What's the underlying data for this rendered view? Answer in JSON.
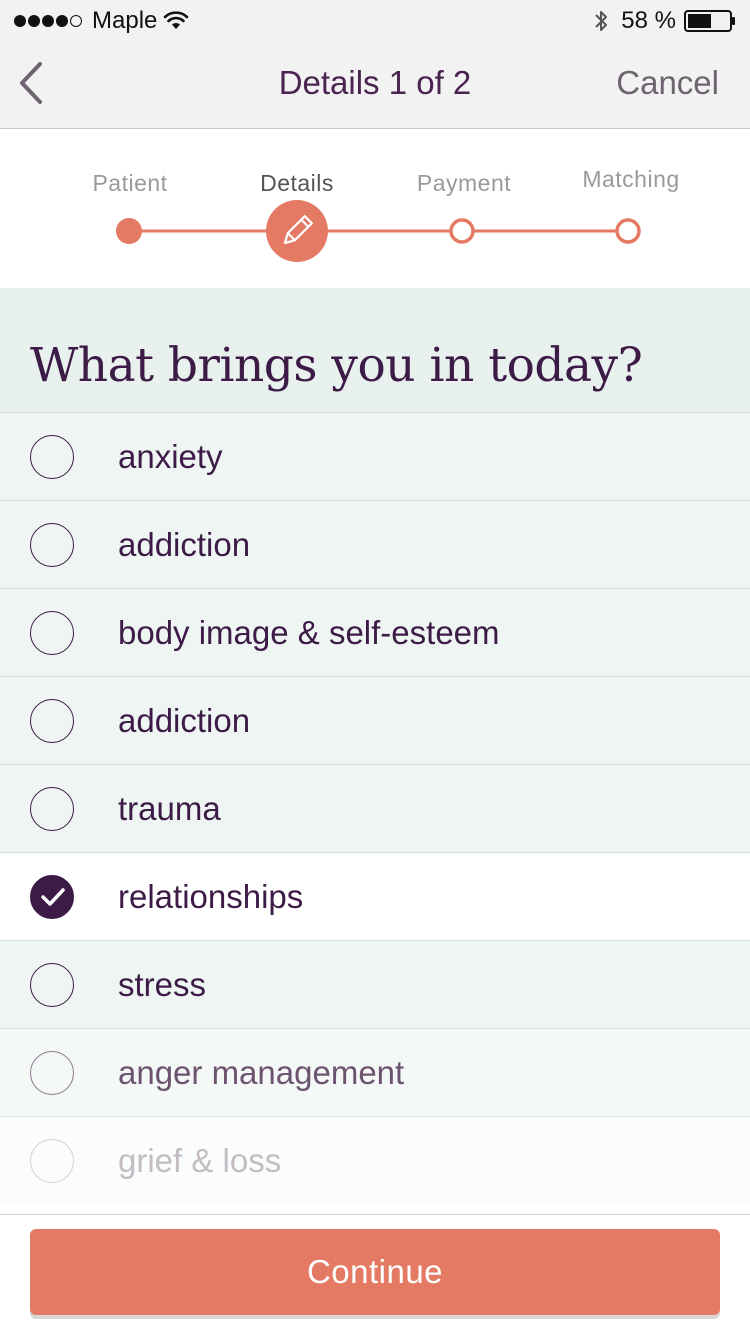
{
  "status_bar": {
    "carrier": "Maple",
    "battery_percent": "58 %",
    "signal_bars_filled": 4,
    "signal_bars_total": 5,
    "battery_level": 0.58,
    "icons": [
      "wifi-icon",
      "bluetooth-icon",
      "battery-icon"
    ]
  },
  "nav": {
    "back_icon": "chevron-left-icon",
    "title": "Details 1 of 2",
    "cancel_label": "Cancel"
  },
  "stepper": {
    "steps": [
      {
        "label": "Patient",
        "state": "completed"
      },
      {
        "label": "Details",
        "state": "current",
        "icon": "pencil-icon"
      },
      {
        "label": "Payment",
        "state": "upcoming"
      },
      {
        "label": "Matching",
        "state": "upcoming"
      }
    ]
  },
  "question": {
    "title": "What brings you in today?"
  },
  "options": [
    {
      "label": "anxiety",
      "selected": false
    },
    {
      "label": "addiction",
      "selected": false
    },
    {
      "label": "body image & self-esteem",
      "selected": false
    },
    {
      "label": "addiction",
      "selected": false
    },
    {
      "label": "trauma",
      "selected": false
    },
    {
      "label": "relationships",
      "selected": true
    },
    {
      "label": "stress",
      "selected": false
    },
    {
      "label": "anger management",
      "selected": false
    },
    {
      "label": "grief & loss",
      "selected": false
    }
  ],
  "footer": {
    "continue_label": "Continue"
  },
  "colors": {
    "accent": "#e47a63",
    "primary_text": "#3d1b47",
    "list_background": "#eef5f2"
  }
}
